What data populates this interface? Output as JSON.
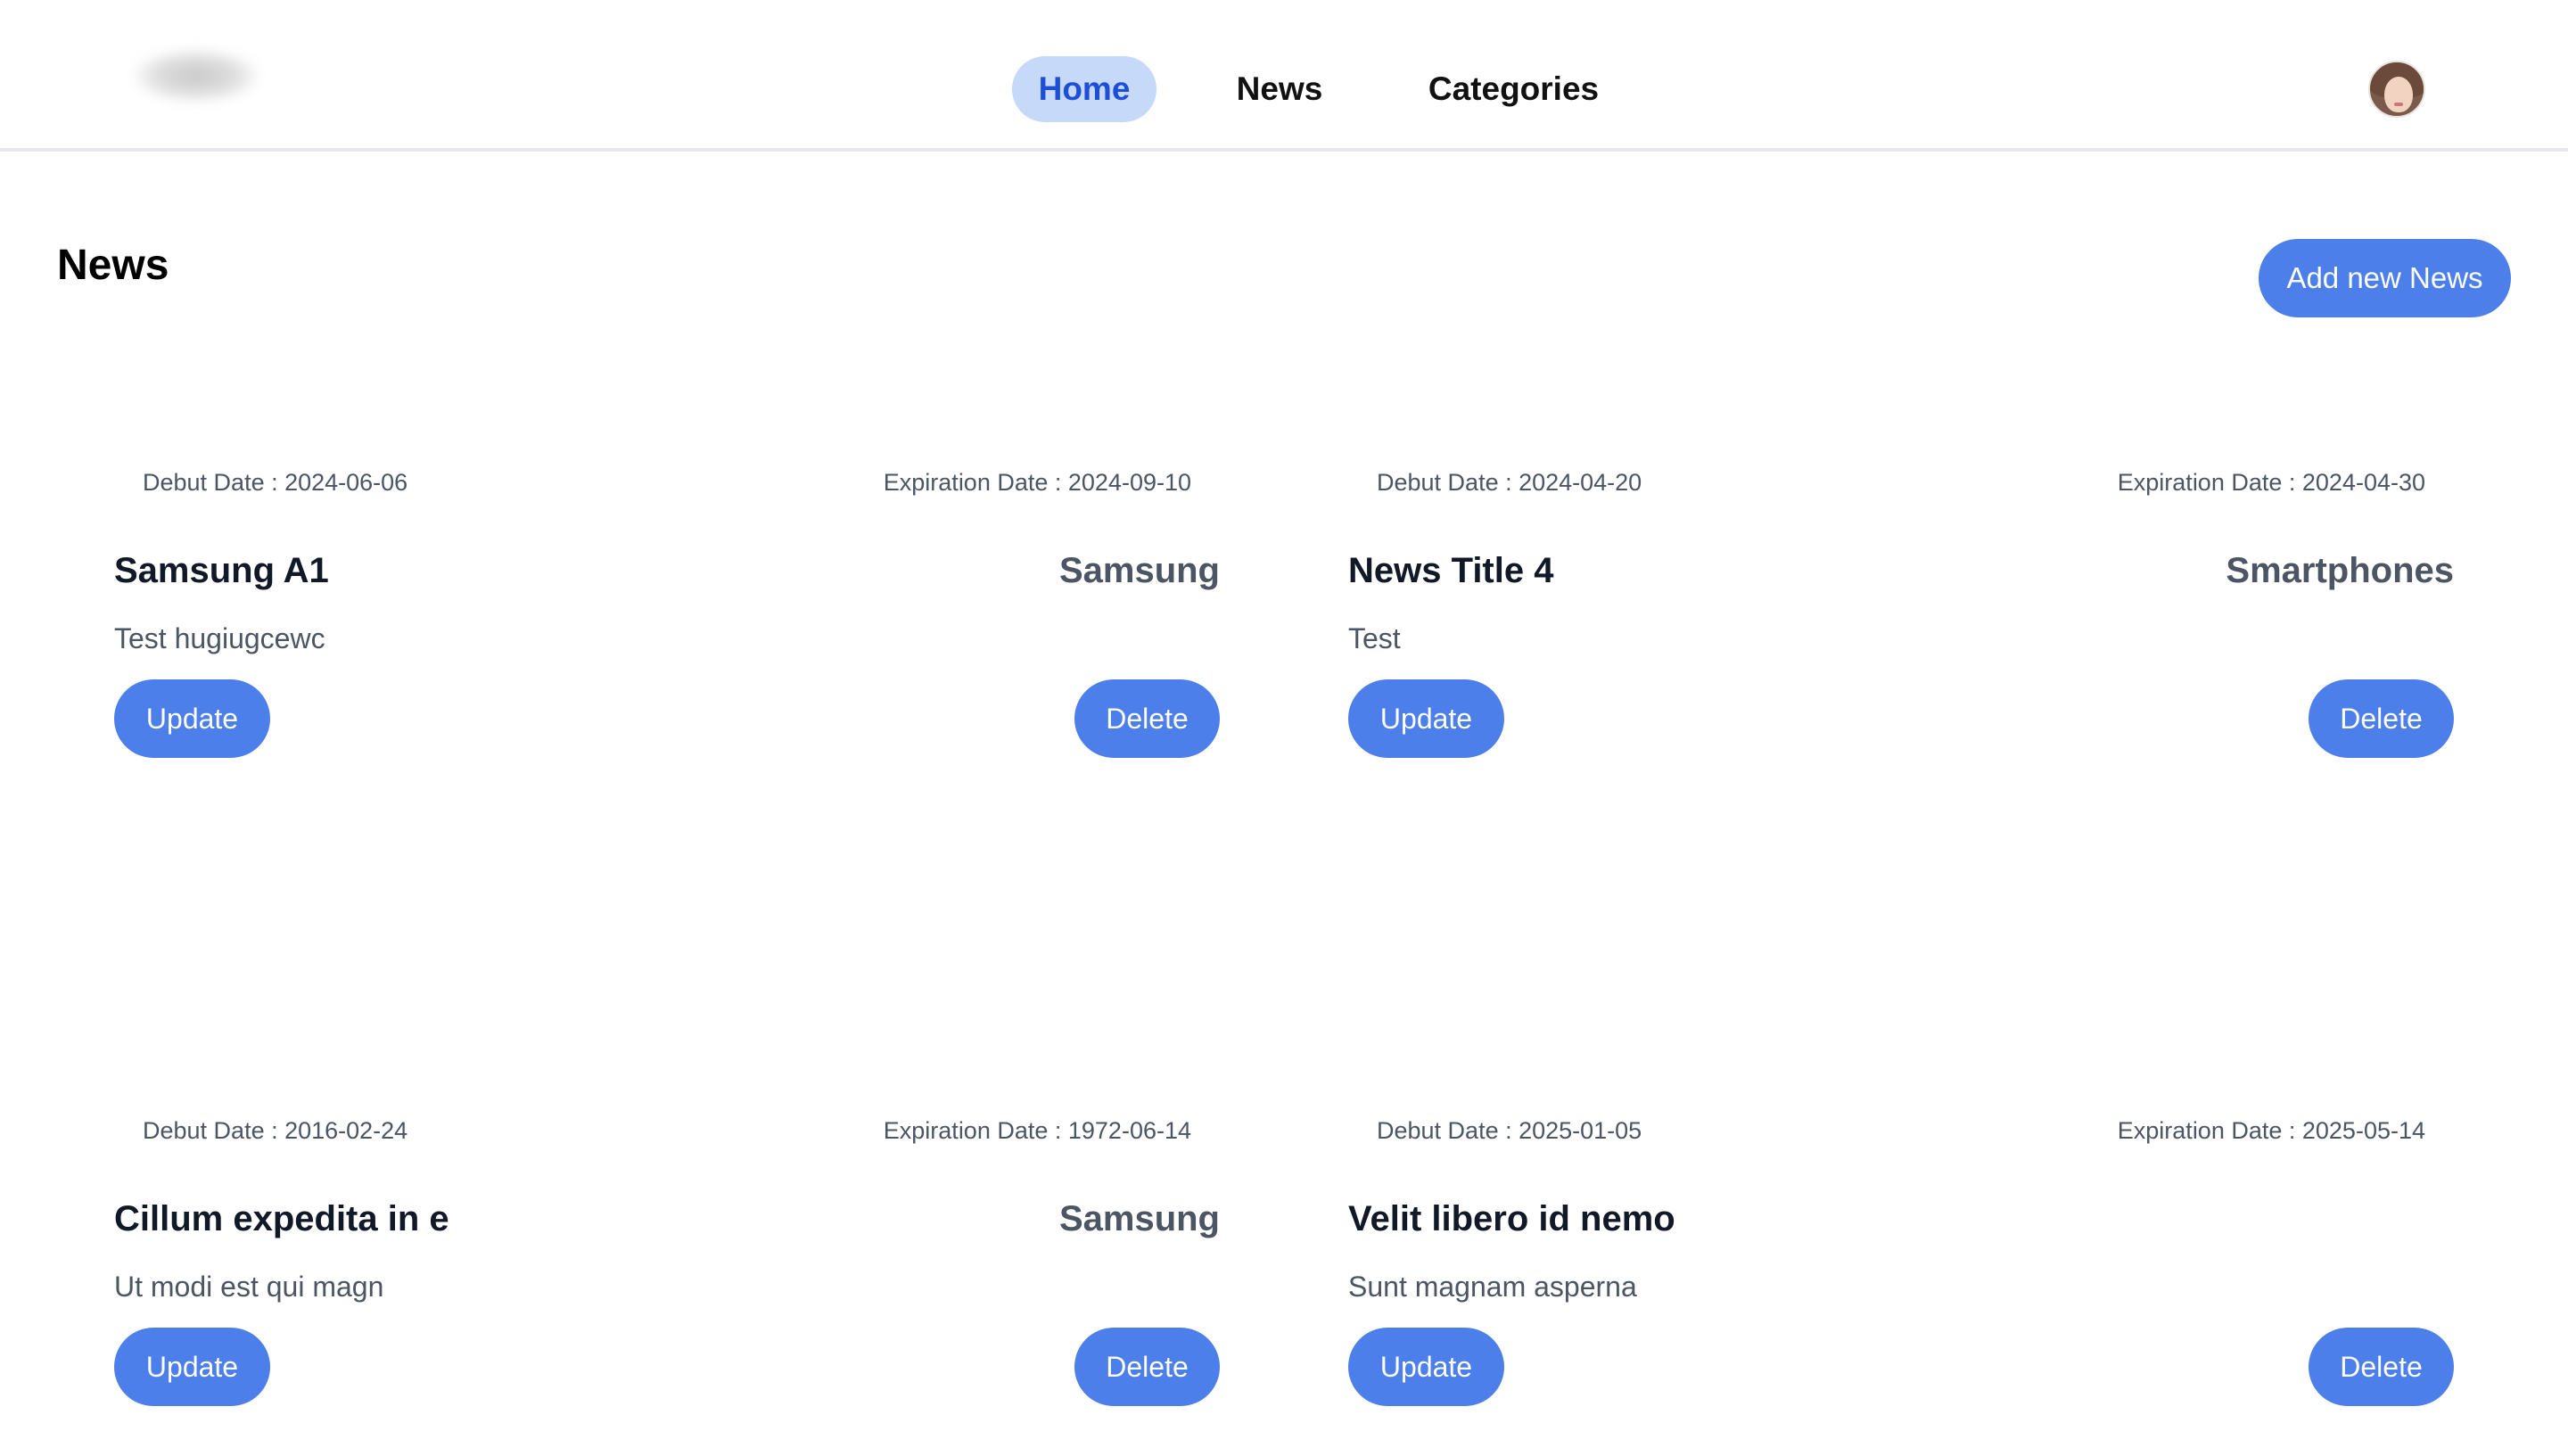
{
  "nav": {
    "items": [
      {
        "label": "Home",
        "active": true
      },
      {
        "label": "News",
        "active": false
      },
      {
        "label": "Categories",
        "active": false
      }
    ]
  },
  "page": {
    "title": "News",
    "add_button_label": "Add new News"
  },
  "news": [
    {
      "debut": "Debut Date : 2024-06-06",
      "expiration": "Expiration Date : 2024-09-10",
      "title": "Samsung A1",
      "category": "Samsung",
      "description": "Test hugiugcewc",
      "update_label": "Update",
      "delete_label": "Delete"
    },
    {
      "debut": "Debut Date : 2024-04-20",
      "expiration": "Expiration Date : 2024-04-30",
      "title": "News Title 4",
      "category": "Smartphones",
      "description": "Test",
      "update_label": "Update",
      "delete_label": "Delete"
    },
    {
      "debut": "Debut Date : 2016-02-24",
      "expiration": "Expiration Date : 1972-06-14",
      "title": "Cillum expedita in e",
      "category": "Samsung",
      "description": "Ut modi est qui magn",
      "update_label": "Update",
      "delete_label": "Delete"
    },
    {
      "debut": "Debut Date : 2025-01-05",
      "expiration": "Expiration Date : 2025-05-14",
      "title": "Velit libero id nemo",
      "category": "",
      "description": "Sunt magnam asperna",
      "update_label": "Update",
      "delete_label": "Delete"
    }
  ],
  "colors": {
    "accent": "#4c7fea",
    "nav_active_bg": "#c7d9f9",
    "nav_active_text": "#1d4ed8"
  },
  "icons": {
    "avatar": "user-avatar"
  }
}
